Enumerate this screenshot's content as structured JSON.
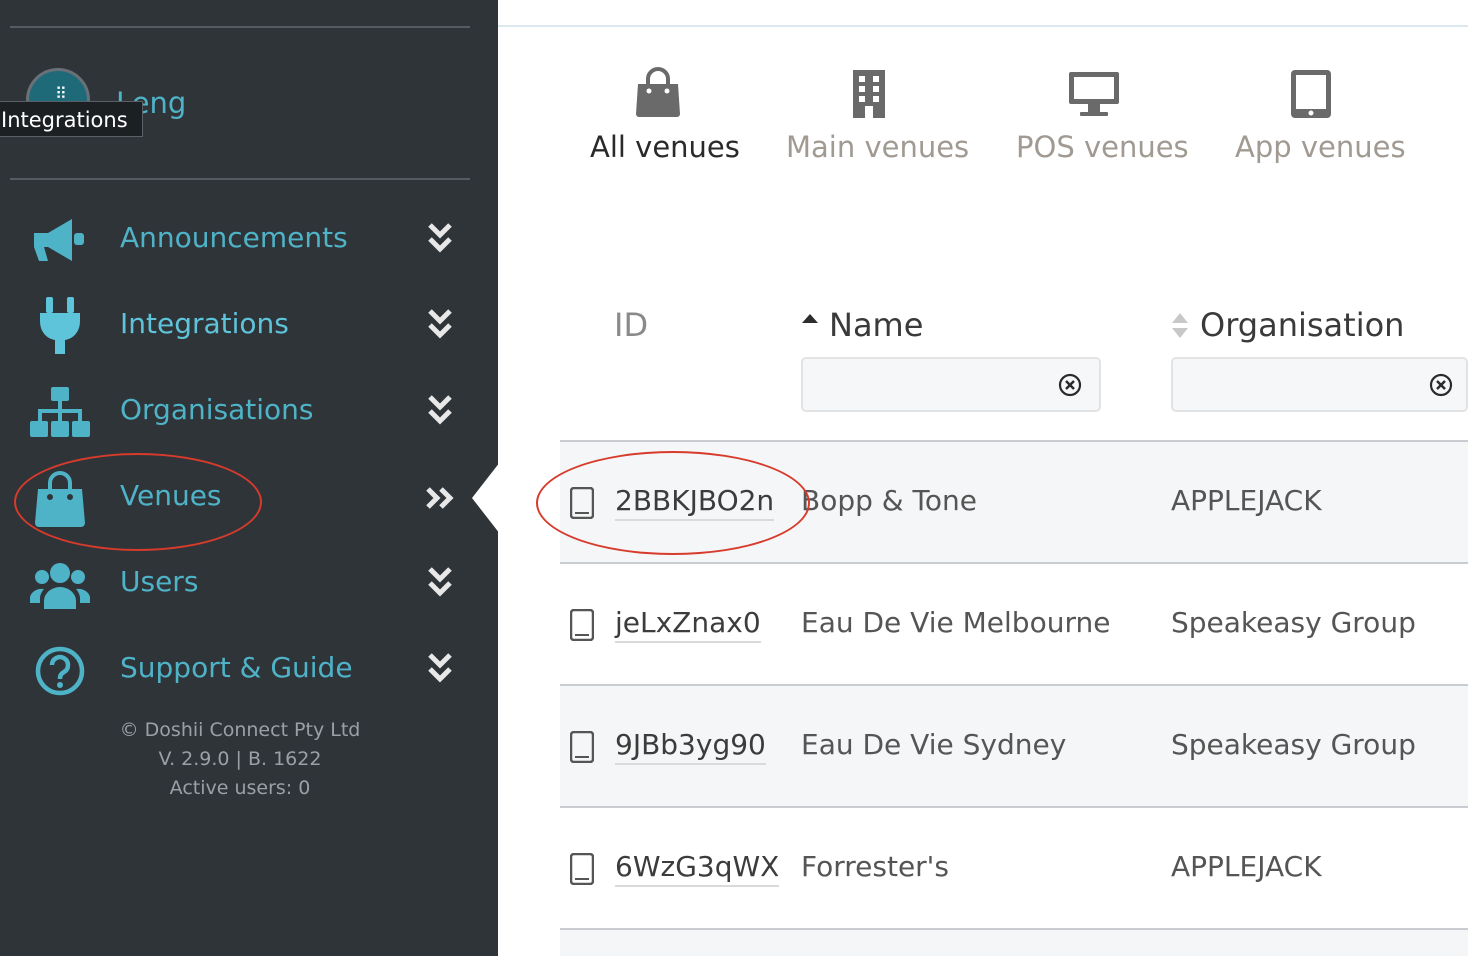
{
  "sidebar": {
    "user": {
      "name": "Leng",
      "avatar_icon": "avatar-dots-icon"
    },
    "tooltip": "Integrations",
    "items": [
      {
        "label": "Announcements",
        "icon": "megaphone-icon",
        "chevron": "chevron-double-down-icon"
      },
      {
        "label": "Integrations",
        "icon": "plug-icon",
        "chevron": "chevron-double-down-icon"
      },
      {
        "label": "Organisations",
        "icon": "sitemap-icon",
        "chevron": "chevron-double-down-icon"
      },
      {
        "label": "Venues",
        "icon": "shopping-bag-icon",
        "chevron": "chevron-double-right-icon"
      },
      {
        "label": "Users",
        "icon": "users-icon",
        "chevron": "chevron-double-down-icon"
      },
      {
        "label": "Support & Guide",
        "icon": "question-circle-icon",
        "chevron": "chevron-double-down-icon"
      }
    ],
    "footer": {
      "company": "© Doshii Connect Pty Ltd",
      "version": "V. 2.9.0 | B. 1622",
      "active_users": "Active users: 0"
    }
  },
  "tabs": [
    {
      "label": "All venues",
      "icon": "shopping-bag-icon",
      "active": true
    },
    {
      "label": "Main venues",
      "icon": "building-icon",
      "active": false
    },
    {
      "label": "POS venues",
      "icon": "desktop-icon",
      "active": false
    },
    {
      "label": "App venues",
      "icon": "tablet-icon",
      "active": false
    }
  ],
  "table": {
    "columns": {
      "id": "ID",
      "name": "Name",
      "organisation": "Organisation"
    },
    "filters": {
      "name_value": "",
      "organisation_value": ""
    },
    "rows": [
      {
        "id": "2BBKJBO2n",
        "name": "Bopp & Tone",
        "organisation": "APPLEJACK"
      },
      {
        "id": "jeLxZnax0",
        "name": "Eau De Vie Melbourne",
        "organisation": "Speakeasy Group"
      },
      {
        "id": "9JBb3yg90",
        "name": "Eau De Vie Sydney",
        "organisation": "Speakeasy Group"
      },
      {
        "id": "6WzG3qWX",
        "name": "Forrester's",
        "organisation": "APPLEJACK"
      }
    ]
  },
  "colors": {
    "sidebar_bg": "#2f3439",
    "accent": "#4fb3c8",
    "annotation": "#d63b2b",
    "row_shade": "#f5f6f7"
  }
}
